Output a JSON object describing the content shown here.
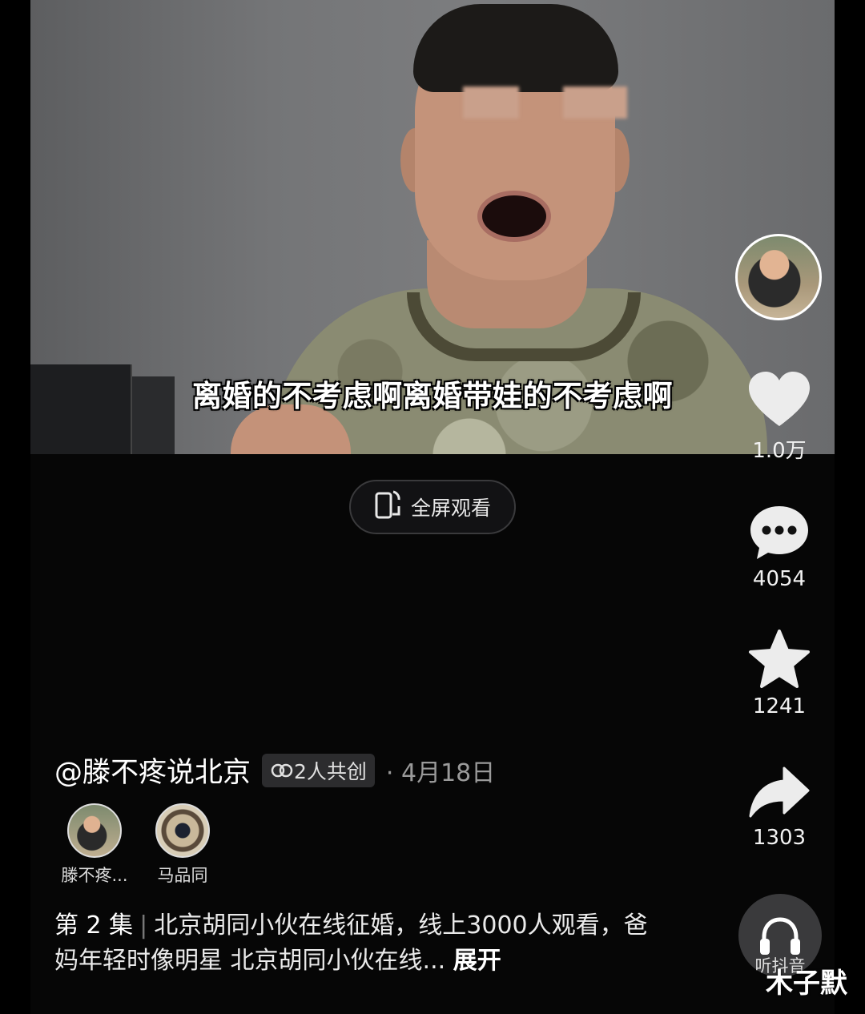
{
  "video": {
    "subtitle": "离婚的不考虑啊离婚带娃的不考虑啊"
  },
  "fullscreen_button": {
    "label": "全屏观看",
    "icon": "rotate-screen-icon"
  },
  "actions": {
    "like": {
      "icon": "heart-icon",
      "count": "1.0万"
    },
    "comment": {
      "icon": "comment-bubble-icon",
      "count": "4054"
    },
    "favorite": {
      "icon": "star-icon",
      "count": "1241"
    },
    "share": {
      "icon": "share-arrow-icon",
      "count": "1303"
    },
    "listen": {
      "icon": "headphones-icon",
      "label": "听抖音"
    }
  },
  "post": {
    "author": "@滕不疼说北京",
    "collab_badge": "2人共创",
    "date": "· 4月18日",
    "creators": [
      {
        "name": "滕不疼..."
      },
      {
        "name": "马品同"
      }
    ],
    "episode": "第 2 集",
    "description": "北京胡同小伙在线征婚，线上3000人观看，爸妈年轻时像明星 北京胡同小伙在线...",
    "expand_label": "展开"
  },
  "watermark": "木子默"
}
